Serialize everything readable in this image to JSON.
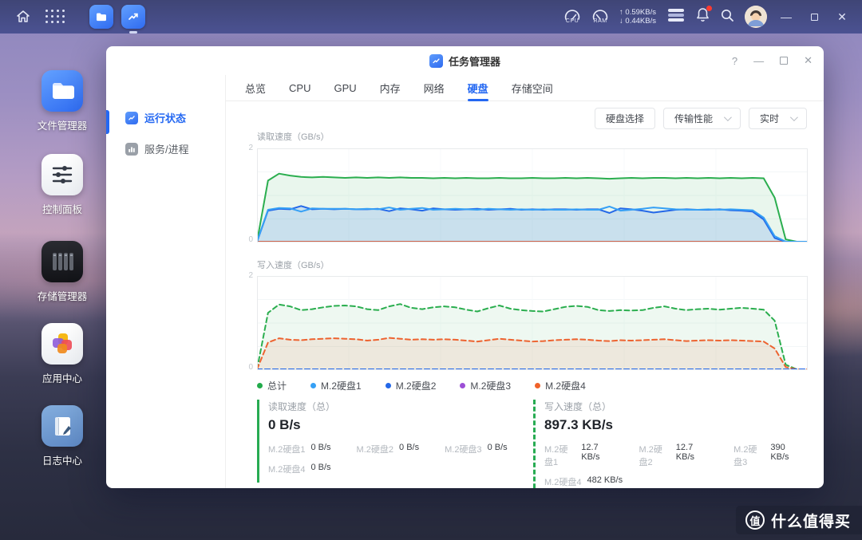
{
  "taskbar": {
    "cpu_label": "CPU",
    "ram_label": "RAM",
    "net_up": "↑ 0.59KB/s",
    "net_down": "↓ 0.44KB/s"
  },
  "desktop": {
    "icons": [
      {
        "label": "文件管理器"
      },
      {
        "label": "控制面板"
      },
      {
        "label": "存储管理器"
      },
      {
        "label": "应用中心"
      },
      {
        "label": "日志中心"
      }
    ]
  },
  "window": {
    "title": "任务管理器",
    "help_label": "?",
    "sidebar": [
      {
        "label": "运行状态"
      },
      {
        "label": "服务/进程"
      }
    ],
    "tabs": [
      {
        "label": "总览"
      },
      {
        "label": "CPU"
      },
      {
        "label": "GPU"
      },
      {
        "label": "内存"
      },
      {
        "label": "网络"
      },
      {
        "label": "硬盘"
      },
      {
        "label": "存储空间"
      }
    ],
    "toolbar": {
      "disk_select": "硬盘选择",
      "metric": "传输性能",
      "interval": "实时"
    }
  },
  "legend": [
    {
      "label": "总计",
      "color": "#22ab4b"
    },
    {
      "label": "M.2硬盘1",
      "color": "#36a0f5"
    },
    {
      "label": "M.2硬盘2",
      "color": "#2468e8"
    },
    {
      "label": "M.2硬盘3",
      "color": "#9c4fd6"
    },
    {
      "label": "M.2硬盘4",
      "color": "#f0622a"
    }
  ],
  "stats": {
    "read": {
      "title": "读取速度（总）",
      "value": "0 B/s",
      "items": [
        {
          "label": "M.2硬盘1",
          "value": "0 B/s"
        },
        {
          "label": "M.2硬盘2",
          "value": "0 B/s"
        },
        {
          "label": "M.2硬盘3",
          "value": "0 B/s"
        },
        {
          "label": "M.2硬盘4",
          "value": "0 B/s"
        }
      ]
    },
    "write": {
      "title": "写入速度（总）",
      "value": "897.3 KB/s",
      "items": [
        {
          "label": "M.2硬盘1",
          "value": "12.7 KB/s"
        },
        {
          "label": "M.2硬盘2",
          "value": "12.7 KB/s"
        },
        {
          "label": "M.2硬盘3",
          "value": "390 KB/s"
        },
        {
          "label": "M.2硬盘4",
          "value": "482 KB/s"
        }
      ]
    }
  },
  "watermark": {
    "badge": "值",
    "text": "什么值得买"
  },
  "chart_data": [
    {
      "type": "line",
      "title": "读取速度（GB/s）",
      "ylim": [
        0,
        2
      ],
      "ymax_label": "2",
      "ymin_label": "0",
      "x_range": [
        0,
        100
      ],
      "grid": true,
      "series": [
        {
          "name": "总计",
          "color": "#2bae4f",
          "fill": "rgba(40,170,80,0.10)",
          "dash": false,
          "values": [
            0,
            1.32,
            1.47,
            1.43,
            1.4,
            1.39,
            1.4,
            1.39,
            1.38,
            1.39,
            1.38,
            1.39,
            1.38,
            1.39,
            1.38,
            1.38,
            1.37,
            1.38,
            1.37,
            1.38,
            1.37,
            1.37,
            1.38,
            1.37,
            1.37,
            1.38,
            1.37,
            1.37,
            1.38,
            1.37,
            1.38,
            1.37,
            1.36,
            1.37,
            1.38,
            1.37,
            1.38,
            1.38,
            1.37,
            1.38,
            1.37,
            1.38,
            1.37,
            1.38,
            1.37,
            1.38,
            1.37,
            0.95,
            0.05,
            0,
            0
          ]
        },
        {
          "name": "M.2硬盘3",
          "color": "#9c4fd6",
          "dash": false,
          "flat": 0
        },
        {
          "name": "M.2硬盘4",
          "color": "#ed6330",
          "dash": false,
          "flat": 0
        },
        {
          "name": "M.2硬盘2",
          "color": "#2468e8",
          "fill": "rgba(47,120,235,0.17)",
          "dash": false,
          "values": [
            0,
            0.67,
            0.71,
            0.7,
            0.77,
            0.7,
            0.71,
            0.7,
            0.71,
            0.7,
            0.7,
            0.71,
            0.66,
            0.72,
            0.7,
            0.67,
            0.72,
            0.7,
            0.69,
            0.7,
            0.71,
            0.69,
            0.7,
            0.71,
            0.69,
            0.7,
            0.69,
            0.7,
            0.7,
            0.69,
            0.7,
            0.7,
            0.62,
            0.72,
            0.7,
            0.67,
            0.63,
            0.66,
            0.69,
            0.7,
            0.69,
            0.69,
            0.7,
            0.68,
            0.67,
            0.65,
            0.48,
            0.08,
            0,
            0,
            0
          ]
        },
        {
          "name": "M.2硬盘1",
          "color": "#36a0f5",
          "dash": false,
          "values": [
            0,
            0.69,
            0.73,
            0.72,
            0.65,
            0.72,
            0.71,
            0.71,
            0.71,
            0.7,
            0.71,
            0.7,
            0.74,
            0.69,
            0.71,
            0.73,
            0.69,
            0.7,
            0.71,
            0.7,
            0.69,
            0.71,
            0.7,
            0.69,
            0.7,
            0.69,
            0.7,
            0.69,
            0.69,
            0.7,
            0.69,
            0.69,
            0.76,
            0.67,
            0.69,
            0.71,
            0.74,
            0.72,
            0.7,
            0.69,
            0.69,
            0.7,
            0.69,
            0.7,
            0.69,
            0.68,
            0.52,
            0.12,
            0,
            0,
            0
          ]
        }
      ]
    },
    {
      "type": "line",
      "title": "写入速度（GB/s）",
      "ylim": [
        0,
        2
      ],
      "ymax_label": "2",
      "ymin_label": "0",
      "x_range": [
        0,
        100
      ],
      "grid": true,
      "series": [
        {
          "name": "总计",
          "color": "#2bae4f",
          "fill": "rgba(40,170,80,0.08)",
          "dash": true,
          "values": [
            0,
            1.22,
            1.4,
            1.36,
            1.28,
            1.3,
            1.34,
            1.37,
            1.38,
            1.36,
            1.3,
            1.28,
            1.36,
            1.41,
            1.33,
            1.3,
            1.34,
            1.36,
            1.34,
            1.29,
            1.25,
            1.32,
            1.38,
            1.31,
            1.28,
            1.26,
            1.25,
            1.3,
            1.35,
            1.37,
            1.35,
            1.28,
            1.26,
            1.28,
            1.27,
            1.28,
            1.33,
            1.36,
            1.31,
            1.28,
            1.3,
            1.31,
            1.29,
            1.31,
            1.33,
            1.31,
            1.29,
            1.05,
            0.1,
            0,
            0
          ]
        },
        {
          "name": "M.2硬盘3",
          "color": "#9c4fd6",
          "dash": true,
          "flat": 0
        },
        {
          "name": "M.2硬盘4",
          "color": "#ed6330",
          "fill": "rgba(235,95,45,0.10)",
          "dash": true,
          "values": [
            0,
            0.58,
            0.67,
            0.64,
            0.63,
            0.65,
            0.66,
            0.67,
            0.66,
            0.65,
            0.62,
            0.64,
            0.68,
            0.66,
            0.64,
            0.65,
            0.64,
            0.65,
            0.64,
            0.62,
            0.6,
            0.63,
            0.66,
            0.64,
            0.62,
            0.6,
            0.61,
            0.63,
            0.64,
            0.65,
            0.64,
            0.62,
            0.61,
            0.63,
            0.62,
            0.63,
            0.64,
            0.65,
            0.63,
            0.61,
            0.62,
            0.63,
            0.62,
            0.63,
            0.62,
            0.61,
            0.6,
            0.45,
            0.05,
            0,
            0
          ]
        },
        {
          "name": "M.2硬盘1",
          "color": "#36a0f5",
          "dash": true,
          "flat": 0
        },
        {
          "name": "M.2硬盘2",
          "color": "#2468e8",
          "dash": true,
          "flat": 0
        }
      ]
    }
  ]
}
